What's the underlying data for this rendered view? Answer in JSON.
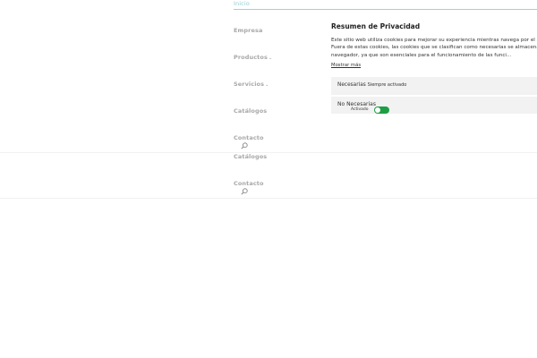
{
  "nav": {
    "inicio": "Inicio",
    "empresa": "Empresa",
    "productos": "Productos",
    "servicios": "Servicios",
    "catalogos": "Catálogos",
    "contacto": "Contacto",
    "chevron": "⌄"
  },
  "privacy": {
    "title": "Resumen de Privacidad",
    "lines": [
      "Este sitio web utiliza cookies para mejorar su experiencia mientras navega por el s",
      "Fuera de estas cookies, las cookies que se clasifican como necesarias se almacena",
      "navegador, ya que son esenciales para el funcionamiento de las funci..."
    ],
    "show_more": "Mostrar más",
    "necessary": {
      "label": "Necesarias",
      "status": "Siempre activado"
    },
    "non_necessary": {
      "label": "No Necesarias",
      "toggle_label": "Activado",
      "enabled": true
    }
  },
  "colors": {
    "accent": "#8fcfd6",
    "toggle": "#1e9e44"
  }
}
